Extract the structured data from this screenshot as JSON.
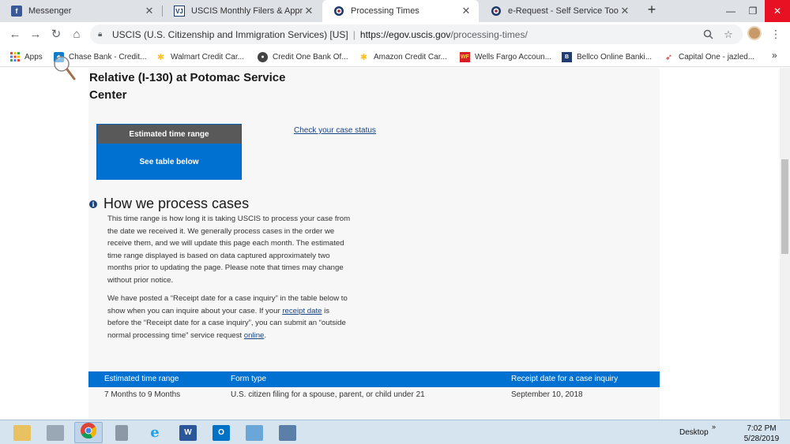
{
  "browser": {
    "tabs": [
      {
        "label": "Messenger",
        "icon": "facebook-icon",
        "active": false
      },
      {
        "label": "USCIS Monthly Filers & Approvals",
        "icon": "vj-icon",
        "active": false
      },
      {
        "label": "Processing Times",
        "icon": "uscis-seal-icon",
        "active": true
      },
      {
        "label": "e-Request - Self Service Tools",
        "icon": "uscis-seal-icon",
        "active": false
      }
    ],
    "new_tab": "+",
    "address": {
      "site_name": "USCIS (U.S. Citizenship and Immigration Services) [US]",
      "divider": "|",
      "url_host": "https://egov.uscis.gov",
      "url_path": "/processing-times/"
    },
    "bookmarks": [
      {
        "label": "Apps",
        "icon": "apps-grid-icon"
      },
      {
        "label": "Chase Bank - Credit...",
        "icon": "chase-icon"
      },
      {
        "label": "Walmart Credit Car...",
        "icon": "walmart-icon"
      },
      {
        "label": "Credit One Bank Of...",
        "icon": "credit-one-icon"
      },
      {
        "label": "Amazon Credit Car...",
        "icon": "amazon-icon"
      },
      {
        "label": "Wells Fargo Accoun...",
        "icon": "wells-fargo-icon"
      },
      {
        "label": "Bellco Online Banki...",
        "icon": "bellco-icon"
      },
      {
        "label": "Capital One - jazled...",
        "icon": "capital-one-icon"
      }
    ],
    "bookmarks_more": "»",
    "colors": {
      "tabstrip": "#dee1e6",
      "omnibox": "#f1f3f4"
    }
  },
  "page": {
    "office_title": "Relative (I-130) at Potomac Service Center",
    "estimate_box": {
      "header": "Estimated time range",
      "body": "See table below"
    },
    "check_status_link": "Check your case status",
    "how_heading": "How we process cases",
    "paragraph1": "This time range is how long it is taking USCIS to process your case from the date we received it. We generally process cases in the order we receive them, and we will update this page each month. The estimated time range displayed is based on data captured approximately two months prior to updating the page. Please note that times may change without prior notice.",
    "paragraph2": {
      "part1": "We have posted a “Receipt date for a case inquiry” in the table below to show when you can inquire about your case. If your ",
      "link1": "receipt date",
      "part2": " is before the “Receipt date for a case inquiry”, you can submit an “outside normal processing time” service request ",
      "link2": "online",
      "part3": "."
    },
    "table": {
      "headers": [
        "Estimated time range",
        "Form type",
        "Receipt date for a case inquiry"
      ],
      "rows": [
        [
          "7 Months to 9 Months",
          "U.S. citizen filing for a spouse, parent, or child under 21",
          "September 10, 2018"
        ]
      ]
    },
    "colors": {
      "primary_blue": "#0071d0",
      "box_header_gray": "#595959",
      "link": "#1a4480"
    }
  },
  "taskbar": {
    "apps": [
      {
        "name": "file-explorer-icon"
      },
      {
        "name": "scanner-icon"
      },
      {
        "name": "chrome-icon",
        "active": true
      },
      {
        "name": "calculator-icon"
      },
      {
        "name": "internet-explorer-icon"
      },
      {
        "name": "word-icon"
      },
      {
        "name": "outlook-icon"
      },
      {
        "name": "network-folder-icon"
      },
      {
        "name": "search-tool-icon"
      }
    ],
    "desktop_label": "Desktop",
    "desktop_arrow": "»",
    "time": "7:02 PM",
    "date": "5/28/2019"
  }
}
